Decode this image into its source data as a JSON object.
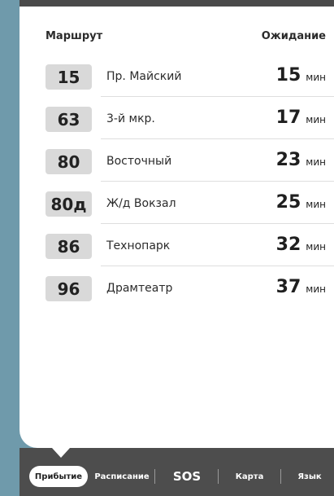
{
  "header": {
    "route_label": "Маршрут",
    "wait_label": "Ожидание"
  },
  "routes": [
    {
      "number": "15",
      "stop": "Пр. Майский",
      "wait": "15",
      "unit": "мин"
    },
    {
      "number": "63",
      "stop": "3-й мкр.",
      "wait": "17",
      "unit": "мин"
    },
    {
      "number": "80",
      "stop": "Восточный",
      "wait": "23",
      "unit": "мин"
    },
    {
      "number": "80д",
      "stop": "Ж/д Вокзал",
      "wait": "25",
      "unit": "мин"
    },
    {
      "number": "86",
      "stop": "Технопарк",
      "wait": "32",
      "unit": "мин"
    },
    {
      "number": "96",
      "stop": "Драмтеатр",
      "wait": "37",
      "unit": "мин"
    }
  ],
  "nav": {
    "arrivals": "Прибытие",
    "schedule": "Расписание",
    "sos": "SOS",
    "map": "Карта",
    "language": "Язык"
  },
  "colors": {
    "background": "#6f9aab",
    "navbar": "#4d4d4d",
    "badge": "#d9d9d9"
  }
}
